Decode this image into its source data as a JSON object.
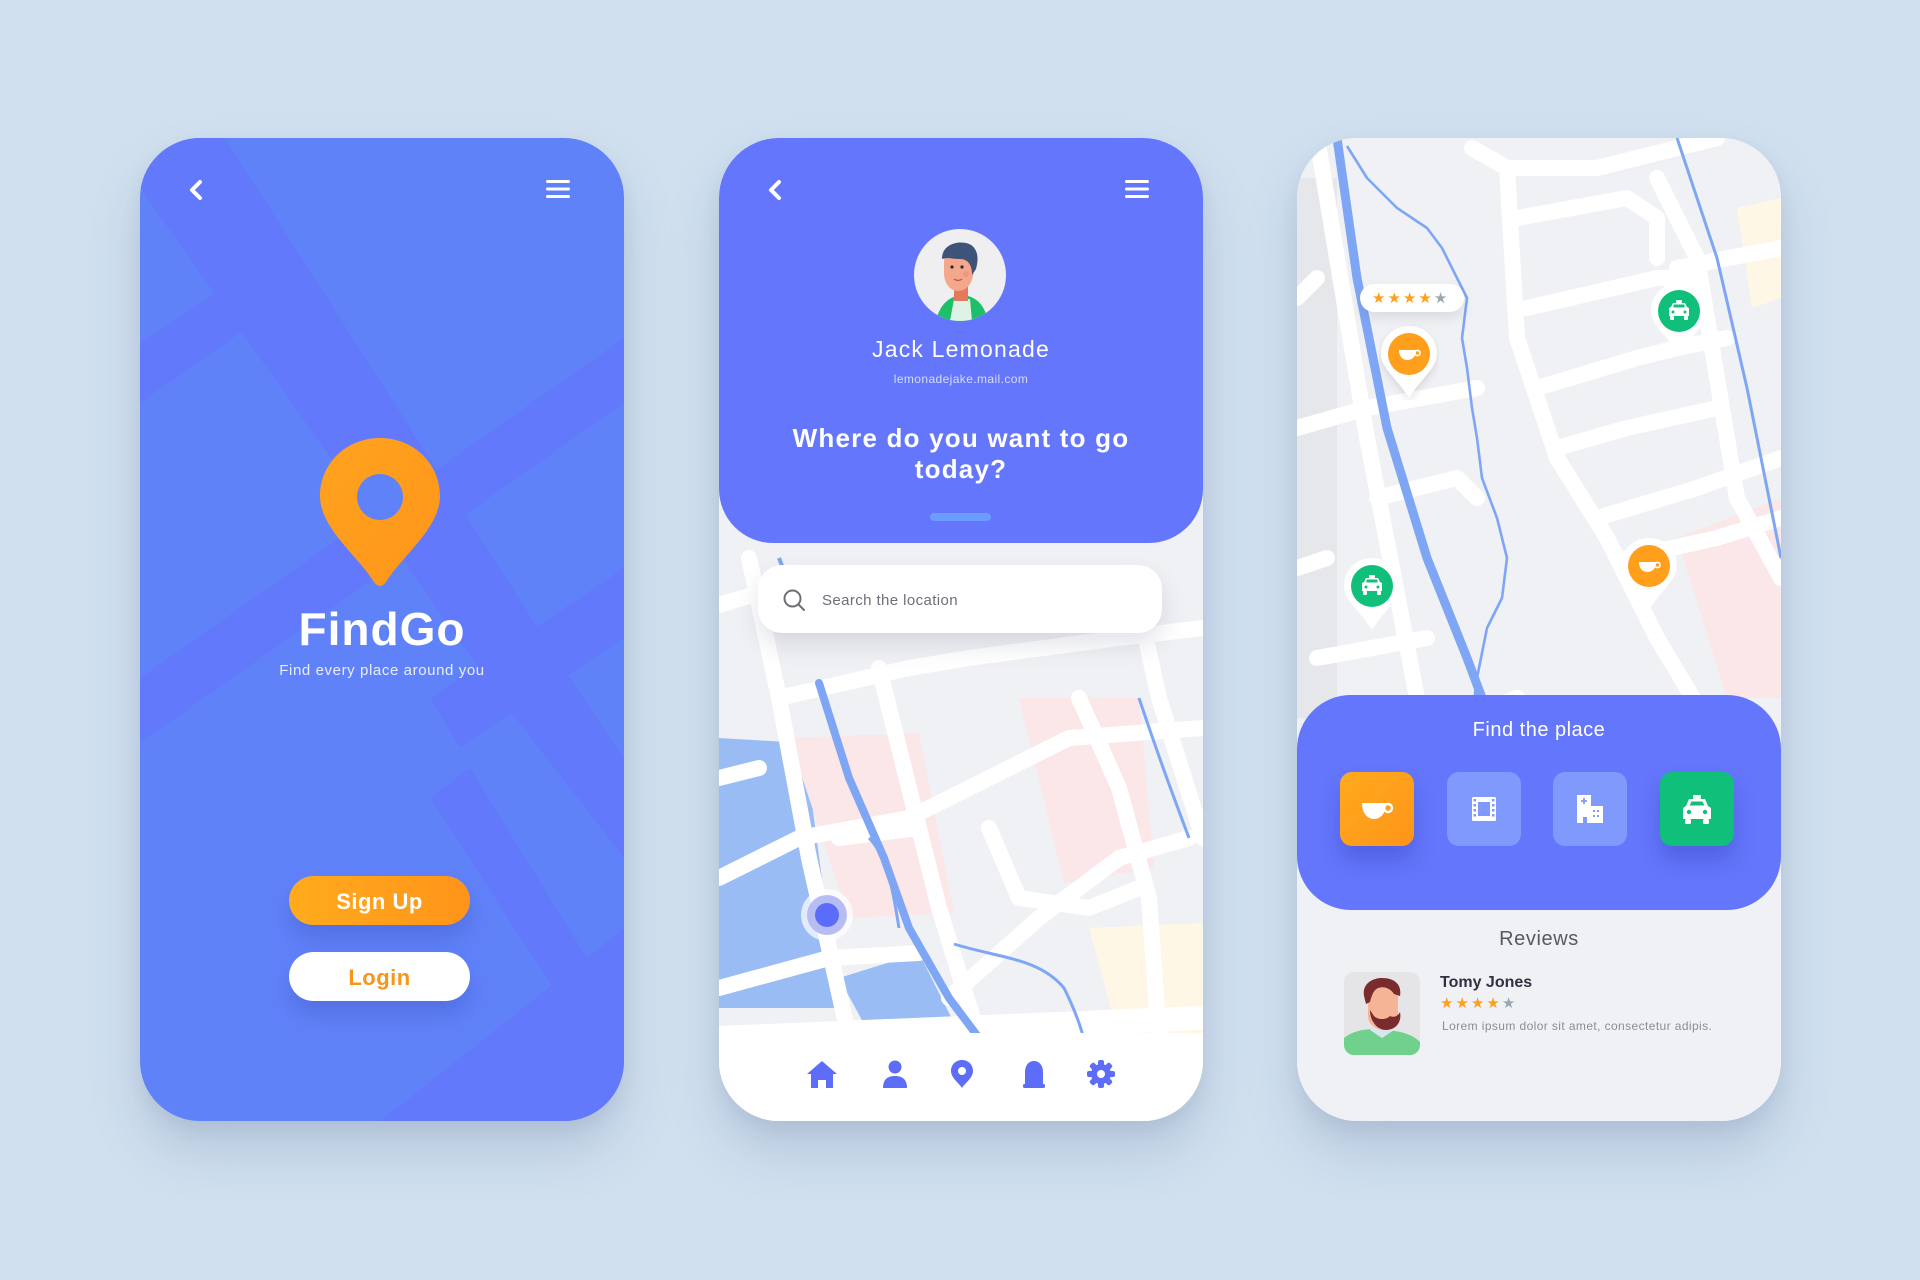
{
  "colors": {
    "background": "#d0e0ef",
    "primary": "#6476fb",
    "primary_login": "#6082f9",
    "accent_orange": "#ff9f1c",
    "accent_green": "#10c07a",
    "star_on": "#ff9f1c",
    "star_off": "#9aa6b2"
  },
  "screen_welcome": {
    "nav": {
      "back_icon": "chevron-left-icon",
      "menu_icon": "hamburger-menu-icon"
    },
    "logo_icon": "map-pin-icon",
    "brand": "FindGo",
    "tagline": "Find every place around you",
    "signup_label": "Sign Up",
    "login_label": "Login"
  },
  "screen_search": {
    "nav": {
      "back_icon": "chevron-left-icon",
      "menu_icon": "hamburger-menu-icon"
    },
    "user": {
      "name": "Jack Lemonade",
      "email": "lemonadejake.mail.com"
    },
    "headline": "Where do you want to go today?",
    "search": {
      "placeholder": "Search the location",
      "value": ""
    },
    "bottom_nav": [
      {
        "icon": "home-icon",
        "label": "Home"
      },
      {
        "icon": "user-icon",
        "label": "Profile"
      },
      {
        "icon": "location-pin-icon",
        "label": "Location"
      },
      {
        "icon": "bell-icon",
        "label": "Notifications"
      },
      {
        "icon": "gear-icon",
        "label": "Settings"
      }
    ]
  },
  "screen_places": {
    "map_rating": {
      "stars": 4,
      "max": 5
    },
    "map_pins": [
      {
        "type": "cafe",
        "icon": "coffee-cup-icon",
        "color": "#ff9f1c"
      },
      {
        "type": "taxi",
        "icon": "taxi-icon",
        "color": "#10c07a"
      },
      {
        "type": "taxi",
        "icon": "taxi-icon",
        "color": "#10c07a"
      },
      {
        "type": "cafe",
        "icon": "coffee-cup-icon",
        "color": "#ff9f1c"
      }
    ],
    "card_title": "Find the place",
    "categories": [
      {
        "name": "Cafe",
        "icon": "coffee-cup-icon",
        "active": true,
        "color": "#ff9f1c"
      },
      {
        "name": "Cinema",
        "icon": "film-icon",
        "active": false
      },
      {
        "name": "Hospital",
        "icon": "hospital-building-icon",
        "active": false
      },
      {
        "name": "Taxi",
        "icon": "taxi-icon",
        "active": true,
        "color": "#10c07a"
      }
    ],
    "reviews_title": "Reviews",
    "reviews": [
      {
        "name": "Tomy Jones",
        "stars": 4,
        "max": 5,
        "text": "Lorem ipsum dolor sit amet, consectetur adipis."
      }
    ]
  }
}
